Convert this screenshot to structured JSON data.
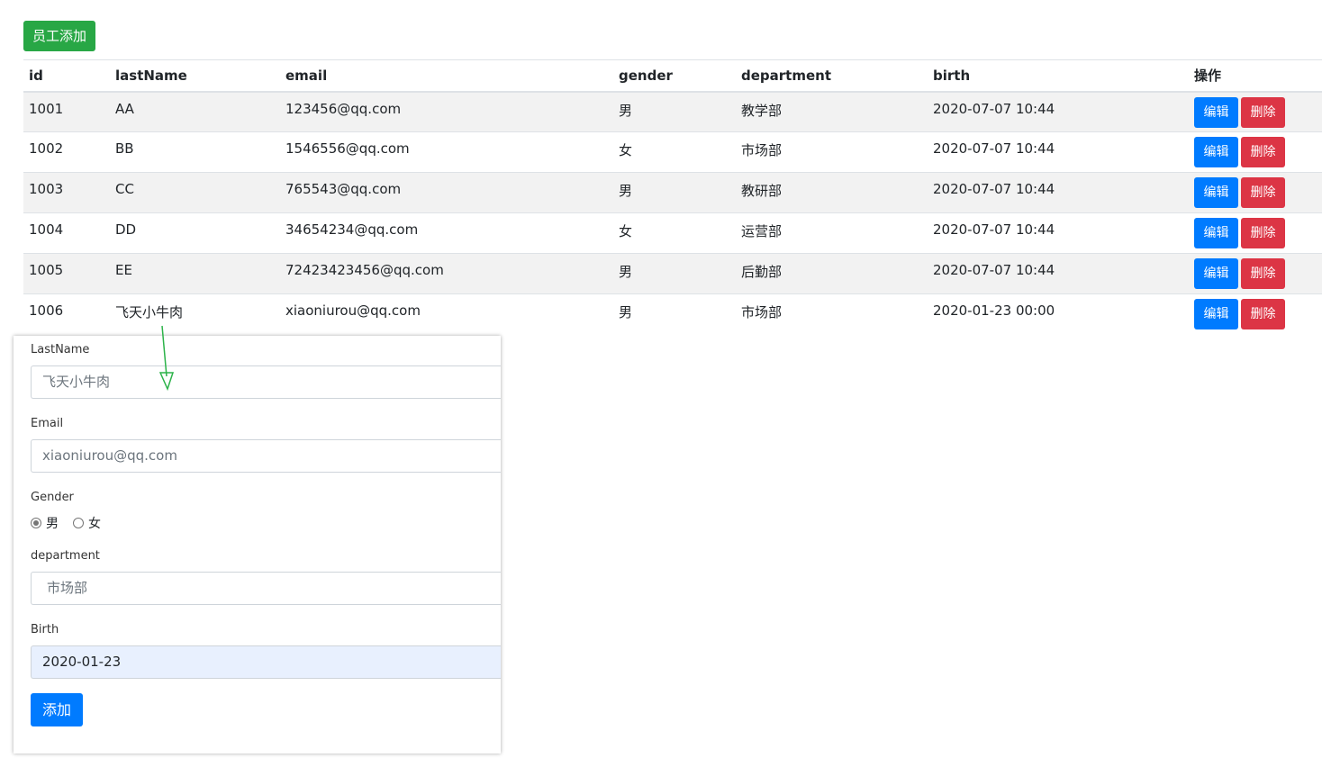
{
  "toolbar": {
    "add_label": "员工添加"
  },
  "table": {
    "headers": [
      "id",
      "lastName",
      "email",
      "gender",
      "department",
      "birth",
      "操作"
    ],
    "rows": [
      {
        "id": "1001",
        "lastName": "AA",
        "email": "123456@qq.com",
        "gender": "男",
        "department": "教学部",
        "birth": "2020-07-07 10:44"
      },
      {
        "id": "1002",
        "lastName": "BB",
        "email": "1546556@qq.com",
        "gender": "女",
        "department": "市场部",
        "birth": "2020-07-07 10:44"
      },
      {
        "id": "1003",
        "lastName": "CC",
        "email": "765543@qq.com",
        "gender": "男",
        "department": "教研部",
        "birth": "2020-07-07 10:44"
      },
      {
        "id": "1004",
        "lastName": "DD",
        "email": "34654234@qq.com",
        "gender": "女",
        "department": "运营部",
        "birth": "2020-07-07 10:44"
      },
      {
        "id": "1005",
        "lastName": "EE",
        "email": "72423423456@qq.com",
        "gender": "男",
        "department": "后勤部",
        "birth": "2020-07-07 10:44"
      },
      {
        "id": "1006",
        "lastName": "飞天小牛肉",
        "email": "xiaoniurou@qq.com",
        "gender": "男",
        "department": "市场部",
        "birth": "2020-01-23 00:00"
      }
    ],
    "edit_label": "编辑",
    "delete_label": "删除"
  },
  "form": {
    "lastname_label": "LastName",
    "lastname_value": "飞天小牛肉",
    "email_label": "Email",
    "email_value": "xiaoniurou@qq.com",
    "gender_label": "Gender",
    "gender_options": [
      "男",
      "女"
    ],
    "gender_selected": "男",
    "department_label": "department",
    "department_value": "市场部",
    "birth_label": "Birth",
    "birth_value": "2020-01-23",
    "submit_label": "添加"
  },
  "colors": {
    "success": "#28a745",
    "primary": "#007bff",
    "danger": "#dc3545",
    "annotation_arrow": "#2db34a"
  }
}
